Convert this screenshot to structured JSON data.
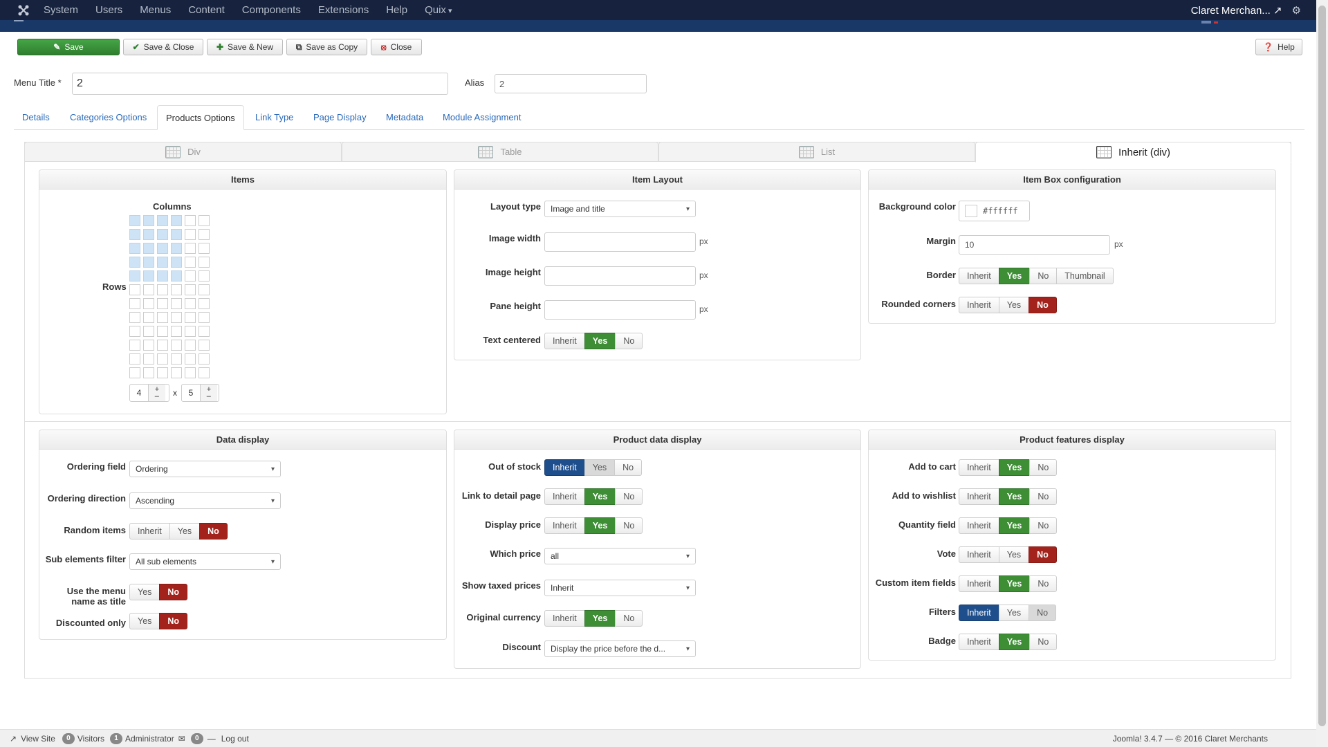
{
  "nav": {
    "menu": [
      "System",
      "Users",
      "Menus",
      "Content",
      "Components",
      "Extensions",
      "Help"
    ],
    "quix": "Quix",
    "user": "Claret Merchan..."
  },
  "toolbar": {
    "save": "Save",
    "save_close": "Save & Close",
    "save_new": "Save & New",
    "save_copy": "Save as Copy",
    "close": "Close",
    "help": "Help"
  },
  "form": {
    "menu_title_label": "Menu Title *",
    "menu_title_value": "2",
    "alias_label": "Alias",
    "alias_value": "2"
  },
  "tabs": [
    "Details",
    "Categories Options",
    "Products Options",
    "Link Type",
    "Page Display",
    "Metadata",
    "Module Assignment"
  ],
  "layout_tabs": [
    "Div",
    "Table",
    "List",
    "Inherit (div)"
  ],
  "items": {
    "title": "Items",
    "columns": "Columns",
    "rows": "Rows",
    "rows_value": "4",
    "cols_value": "5",
    "times": "x",
    "grid_on_cols": 4,
    "grid_on_rows": 5
  },
  "item_layout": {
    "title": "Item Layout",
    "layout_type_label": "Layout type",
    "layout_type_value": "Image and title",
    "image_width_label": "Image width",
    "image_height_label": "Image height",
    "pane_height_label": "Pane height",
    "text_centered_label": "Text centered",
    "px": "px"
  },
  "item_box": {
    "title": "Item Box configuration",
    "bg_label": "Background color",
    "bg_value": "#ffffff",
    "margin_label": "Margin",
    "margin_value": "10",
    "border_label": "Border",
    "rounded_label": "Rounded corners",
    "px": "px"
  },
  "data_display": {
    "title": "Data display",
    "ordering_field_label": "Ordering field",
    "ordering_field_value": "Ordering",
    "ordering_dir_label": "Ordering direction",
    "ordering_dir_value": "Ascending",
    "random_label": "Random items",
    "sub_filter_label": "Sub elements filter",
    "sub_filter_value": "All sub elements",
    "use_menu_label1": "Use the menu",
    "use_menu_label2": "name as title",
    "discounted_label": "Discounted only"
  },
  "product_data": {
    "title": "Product data display",
    "out_of_stock": "Out of stock",
    "link_detail": "Link to detail page",
    "display_price": "Display price",
    "which_price": "Which price",
    "which_price_value": "all",
    "show_taxed": "Show taxed prices",
    "show_taxed_value": "Inherit",
    "orig_currency": "Original currency",
    "discount": "Discount",
    "discount_value": "Display the price before the d..."
  },
  "product_features": {
    "title": "Product features display",
    "add_to_cart": "Add to cart",
    "add_to_wishlist": "Add to wishlist",
    "quantity": "Quantity field",
    "vote": "Vote",
    "custom_fields": "Custom item fields",
    "filters": "Filters",
    "badge": "Badge"
  },
  "btn": {
    "inherit": "Inherit",
    "yes": "Yes",
    "no": "No",
    "thumbnail": "Thumbnail"
  },
  "footer": {
    "view_site": "View Site",
    "visitors_count": "0",
    "visitors": "Visitors",
    "admin_count": "1",
    "admin": "Administrator",
    "msg_count": "0",
    "logout": "Log out",
    "version": "Joomla! 3.4.7",
    "copyright": "— © 2016 Claret Merchants"
  },
  "colors": {
    "green": "#3e8e36",
    "red": "#a3231c",
    "blue": "#1e4e8c",
    "navbar": "#17233e"
  }
}
